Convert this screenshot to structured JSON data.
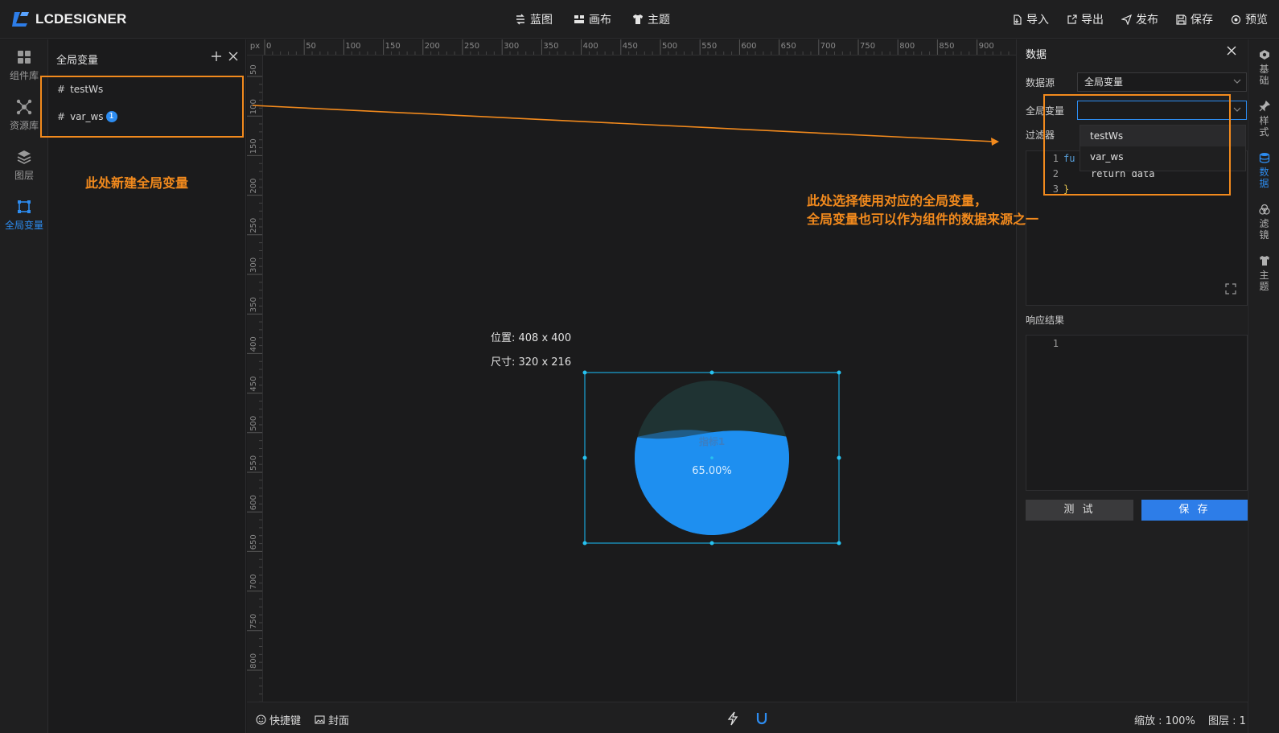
{
  "app": {
    "logo_text": "LCDESIGNER"
  },
  "topnav": [
    {
      "label": "蓝图",
      "icon": "blueprint-icon"
    },
    {
      "label": "画布",
      "icon": "canvas-icon"
    },
    {
      "label": "主题",
      "icon": "theme-shirt-icon"
    }
  ],
  "topactions": [
    {
      "label": "导入",
      "icon": "import-icon"
    },
    {
      "label": "导出",
      "icon": "export-icon"
    },
    {
      "label": "发布",
      "icon": "send-icon"
    },
    {
      "label": "保存",
      "icon": "save-disk-icon"
    },
    {
      "label": "预览",
      "icon": "preview-eye-icon"
    }
  ],
  "leftrail": [
    {
      "label": "组件库",
      "icon": "grid-icon",
      "active": false
    },
    {
      "label": "资源库",
      "icon": "network-icon",
      "active": false
    },
    {
      "label": "图层",
      "icon": "layers-icon",
      "active": false
    },
    {
      "label": "全局变量",
      "icon": "variable-icon",
      "active": true
    }
  ],
  "varpanel": {
    "title": "全局变量",
    "items": [
      {
        "name": "testWs",
        "badge": ""
      },
      {
        "name": "var_ws",
        "badge": "1"
      }
    ]
  },
  "annotations": {
    "left": "此处新建全局变量",
    "right_line1": "此处选择使用对应的全局变量，",
    "right_line2": "全局变量也可以作为组件的数据来源之一"
  },
  "canvas": {
    "unit": "px",
    "ruler_top_labels": [
      "0",
      "50",
      "100",
      "150",
      "200",
      "250",
      "300",
      "350",
      "400",
      "450",
      "500",
      "550",
      "600",
      "650",
      "700",
      "750",
      "800",
      "850",
      "900"
    ],
    "ruler_left_labels": [
      "50",
      "100",
      "150",
      "200",
      "250",
      "300",
      "350",
      "400",
      "450",
      "500",
      "550",
      "600",
      "650",
      "700",
      "750",
      "800"
    ],
    "position_text": "位置: 408 x 400",
    "size_text": "尺寸: 320 x 216",
    "widget": {
      "type": "liquid-fill",
      "label": "指标1",
      "value_text": "65.00%",
      "value": 0.65,
      "fill_color": "#1e8ff0",
      "back_color": "#1f3333"
    }
  },
  "datapanel": {
    "title": "数据",
    "source_label": "数据源",
    "source_value": "全局变量",
    "globalvar_label": "全局变量",
    "globalvar_value": "",
    "filter_label": "过滤器",
    "dropdown_options": [
      "testWs",
      "var_ws"
    ],
    "code_lines": [
      {
        "num": "1",
        "text": "fu"
      },
      {
        "num": "2",
        "text": "return data"
      },
      {
        "num": "3",
        "text": "}"
      }
    ],
    "response_label": "响应结果",
    "response_lines": [
      {
        "num": "1",
        "text": ""
      }
    ],
    "test_button": "测 试",
    "save_button": "保 存"
  },
  "rightrail": [
    {
      "label": "基础",
      "icon": "base-icon",
      "active": false
    },
    {
      "label": "样式",
      "icon": "pin-icon",
      "active": false
    },
    {
      "label": "数据",
      "icon": "database-icon",
      "active": true
    },
    {
      "label": "滤镜",
      "icon": "filter-icon",
      "active": false
    },
    {
      "label": "主题",
      "icon": "theme-shirt-icon",
      "active": false
    }
  ],
  "bottombar": {
    "shortcuts": "快捷键",
    "cover": "封面",
    "zoom": "缩放 : 100%",
    "layers": "图层 : 1"
  },
  "colors": {
    "accent": "#2d8cf0",
    "annotation": "#f28a1d"
  }
}
